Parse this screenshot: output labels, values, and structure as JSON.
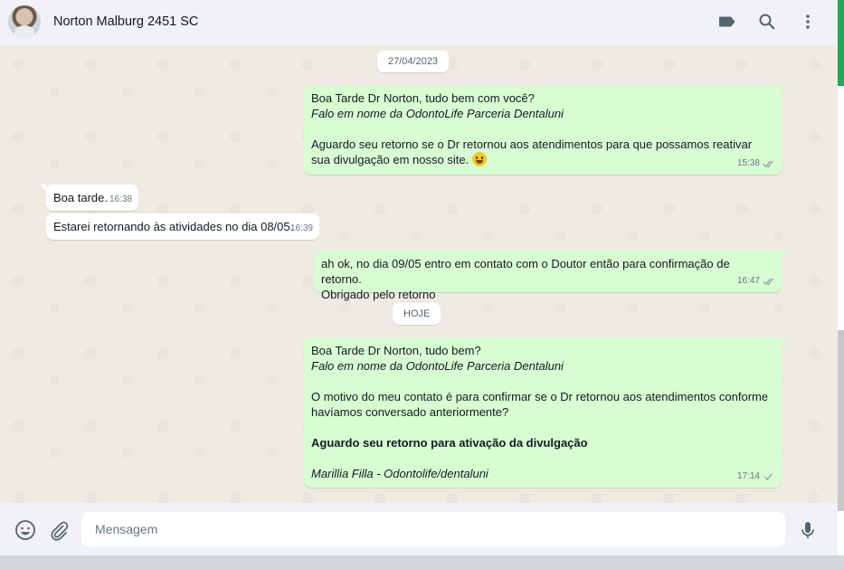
{
  "header": {
    "contact_name": "Norton Malburg 2451 SC",
    "icons": [
      "label-icon",
      "search-icon",
      "menu-icon"
    ]
  },
  "chat": {
    "date1": "27/04/2023",
    "date2": "HOJE",
    "messages": [
      {
        "direction": "outgoing",
        "lines": [
          "Boa Tarde Dr Norton, tudo bem com você?",
          "Falo em nome da OdontoLife Parceria Dentaluni",
          "Aguardo seu retorno se o Dr retornou aos atendimentos para que possamos reativar sua divulgação em nosso site."
        ],
        "time": "15:38",
        "status": "read"
      },
      {
        "direction": "incoming",
        "text": "Boa tarde.",
        "time": "16:38"
      },
      {
        "direction": "incoming",
        "text": "Estarei retornando às atividades no dia 08/05.",
        "time": "16:39"
      },
      {
        "direction": "outgoing",
        "lines": [
          "ah ok, no dia 09/05 entro em contato com o Doutor então  para confirmação de retorno.",
          "Obrigado pelo retorno"
        ],
        "time": "16:47",
        "status": "read"
      },
      {
        "direction": "outgoing",
        "lines": [
          "Boa Tarde Dr Norton, tudo bem?",
          "Falo em nome da OdontoLife Parceria Dentaluni",
          "O motivo do meu contato é para confirmar se o Dr retornou aos atendimentos conforme havíamos conversado anteriormente?",
          "Aguardo seu retorno para ativação da divulgação",
          "Marillia Filla - Odontolife/dentaluni"
        ],
        "time": "17:14",
        "status": "sent"
      }
    ]
  },
  "composer": {
    "placeholder": "Mensagem",
    "icons": [
      "emoji-icon",
      "attach-icon",
      "microphone-icon"
    ]
  },
  "colors": {
    "outgoing_bubble": "#d9fdd3",
    "incoming_bubble": "#ffffff",
    "chat_background": "#efeae2",
    "header_background": "#f0f2f5",
    "scrollbar_accent": "#1fa855"
  }
}
